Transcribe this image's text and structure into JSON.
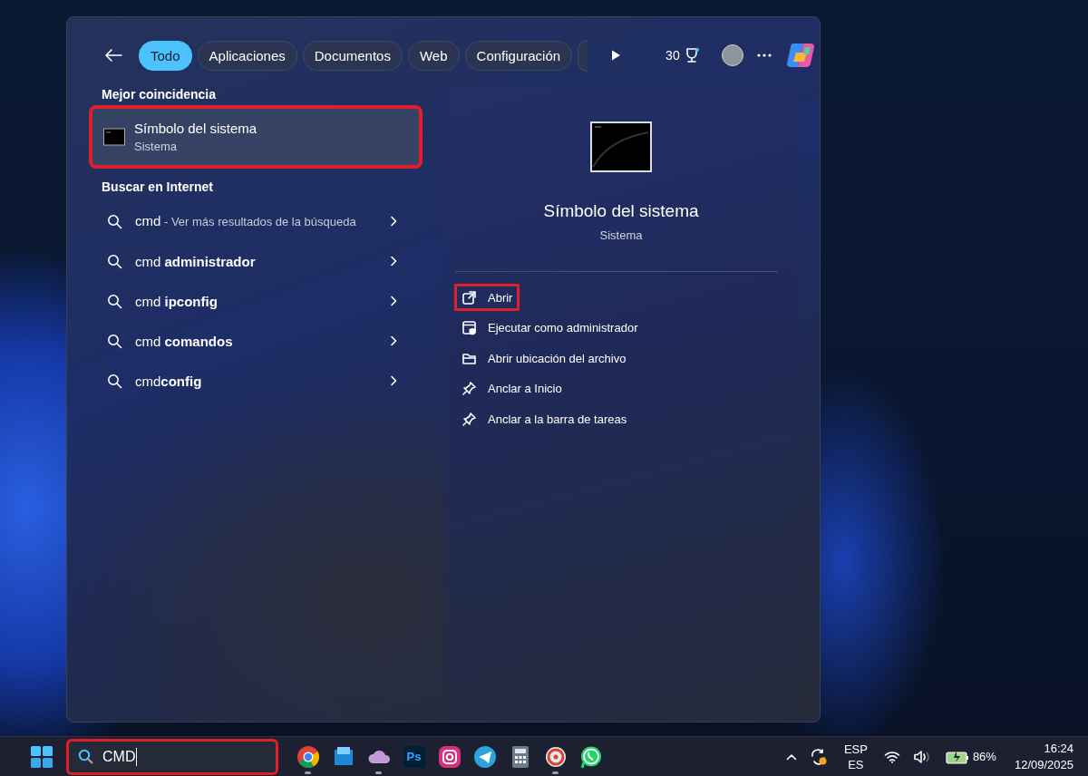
{
  "search_panel": {
    "tabs": [
      {
        "label": "Todo",
        "selected": true
      },
      {
        "label": "Aplicaciones",
        "selected": false
      },
      {
        "label": "Documentos",
        "selected": false
      },
      {
        "label": "Web",
        "selected": false
      },
      {
        "label": "Configuración",
        "selected": false
      }
    ],
    "points": "30",
    "best_match": {
      "heading": "Mejor coincidencia",
      "title": "Símbolo del sistema",
      "subtitle": "Sistema",
      "highlighted": true
    },
    "web_search": {
      "heading": "Buscar en Internet",
      "items": [
        {
          "kind": "more",
          "query": "cmd",
          "note": " - Ver más resultados de la búsqueda"
        },
        {
          "kind": "suggestion",
          "text": "cmd **administrador**"
        },
        {
          "kind": "suggestion",
          "text": "cmd **ipconfig**"
        },
        {
          "kind": "suggestion",
          "text": "cmd **comandos**"
        },
        {
          "kind": "suggestion",
          "text": "cmd**config**"
        }
      ]
    },
    "preview": {
      "title": "Símbolo del sistema",
      "subtitle": "Sistema",
      "actions": [
        {
          "kind": "open",
          "label": "Abrir",
          "highlighted": true
        },
        {
          "kind": "admin",
          "label": "Ejecutar como administrador",
          "highlighted": false
        },
        {
          "kind": "folder",
          "label": "Abrir ubicación del archivo",
          "highlighted": false
        },
        {
          "kind": "pin",
          "label": "Anclar a Inicio",
          "highlighted": false
        },
        {
          "kind": "pin",
          "label": "Anclar a la barra de tareas",
          "highlighted": false
        }
      ]
    }
  },
  "taskbar": {
    "search": {
      "value": "CMD",
      "highlighted": true
    },
    "apps": [
      {
        "kind": "chrome",
        "running": true
      },
      {
        "kind": "explorer",
        "running": false
      },
      {
        "kind": "cloud",
        "running": true
      },
      {
        "kind": "photoshop",
        "label": "Ps",
        "running": false
      },
      {
        "kind": "instagram",
        "running": false
      },
      {
        "kind": "telegram",
        "running": false
      },
      {
        "kind": "calculator",
        "running": false
      },
      {
        "kind": "ring",
        "running": true
      },
      {
        "kind": "whatsapp",
        "running": false
      }
    ],
    "language": {
      "top": "ESP",
      "bottom": "ES"
    },
    "battery": "86%",
    "time": "16:24",
    "date": "12/09/2025"
  }
}
